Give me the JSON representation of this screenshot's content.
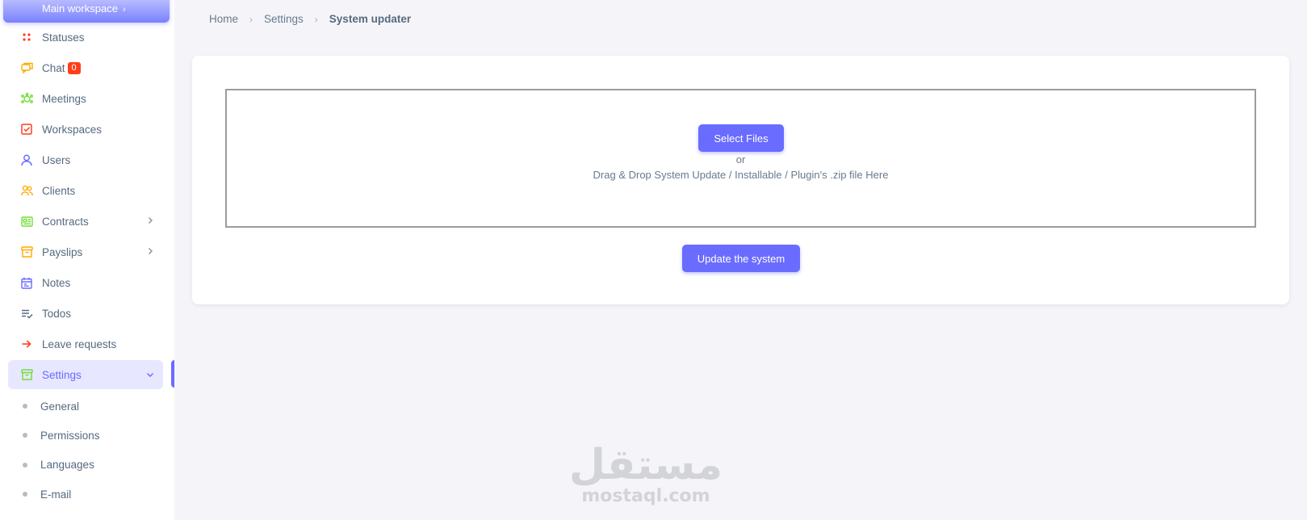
{
  "sidebar": {
    "workspace_switch": "Main workspace",
    "items": [
      {
        "label": "Statuses",
        "icon": "grid-dots-icon",
        "color": "#ff3e1d"
      },
      {
        "label": "Chat",
        "icon": "chat-icon",
        "color": "#ffab00",
        "badge": "0"
      },
      {
        "label": "Meetings",
        "icon": "meetings-icon",
        "color": "#71dd37"
      },
      {
        "label": "Workspaces",
        "icon": "check-square-icon",
        "color": "#ff3e1d"
      },
      {
        "label": "Users",
        "icon": "user-icon",
        "color": "#696cff"
      },
      {
        "label": "Clients",
        "icon": "users-group-icon",
        "color": "#ffab00"
      },
      {
        "label": "Contracts",
        "icon": "id-card-icon",
        "color": "#71dd37"
      },
      {
        "label": "Payslips",
        "icon": "archive-box-icon",
        "color": "#ffab00"
      },
      {
        "label": "Notes",
        "icon": "calendar-note-icon",
        "color": "#696cff"
      },
      {
        "label": "Todos",
        "icon": "list-check-icon",
        "color": "#566a7f"
      },
      {
        "label": "Leave requests",
        "icon": "arrow-right-icon",
        "color": "#ff3e1d"
      },
      {
        "label": "Settings",
        "icon": "settings-box-icon",
        "color": "#71dd37"
      }
    ],
    "settings_sub": [
      {
        "label": "General"
      },
      {
        "label": "Permissions"
      },
      {
        "label": "Languages"
      },
      {
        "label": "E-mail"
      }
    ]
  },
  "breadcrumb": {
    "home": "Home",
    "settings": "Settings",
    "current": "System updater"
  },
  "dropzone": {
    "select_label": "Select Files",
    "or_text": "or",
    "message": "Drag & Drop System Update / Installable / Plugin's .zip file Here"
  },
  "update_button": "Update the system",
  "watermark": {
    "arabic": "مستقل",
    "latin": "mostaql.com"
  },
  "colors": {
    "primary": "#696cff",
    "danger": "#ff3e1d",
    "warning": "#ffab00",
    "success": "#71dd37"
  }
}
